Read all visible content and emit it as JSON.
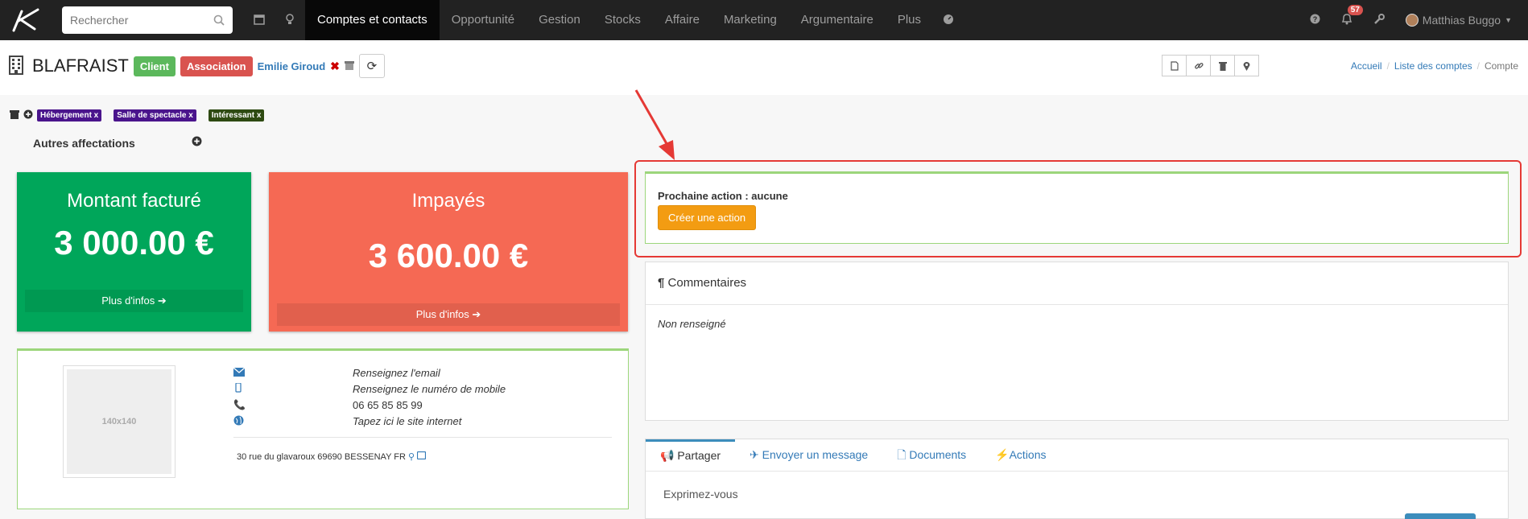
{
  "nav": {
    "search_placeholder": "Rechercher",
    "items": [
      "Comptes et contacts",
      "Opportunité",
      "Gestion",
      "Stocks",
      "Affaire",
      "Marketing",
      "Argumentaire",
      "Plus"
    ],
    "notif_count": "57",
    "user_name": "Matthias Buggo"
  },
  "header": {
    "account_name": "BLAFRAIST",
    "label_client": "Client",
    "label_association": "Association",
    "contact_name": "Emilie Giroud",
    "breadcrumb": [
      "Accueil",
      "Liste des comptes",
      "Compte"
    ]
  },
  "tags": [
    {
      "label": "Hébergement x",
      "color": "#4a148c"
    },
    {
      "label": "Salle de spectacle x",
      "color": "#4a148c"
    },
    {
      "label": "Intéressant x",
      "color": "#2e4a12"
    }
  ],
  "autres_affectations": "Autres affectations",
  "stats": {
    "billed": {
      "title": "Montant facturé",
      "value": "3 000.00 €",
      "more": "Plus d'infos",
      "color": "#00a65a"
    },
    "unpaid": {
      "title": "Impayés",
      "value": "3 600.00 €",
      "more": "Plus d'infos",
      "color": "#f56954"
    }
  },
  "contact": {
    "thumb_label": "140x140",
    "email": "Renseignez l'email",
    "mobile": "Renseignez le numéro de mobile",
    "phone": "06 65 85 85 99",
    "website": "Tapez ici le site internet",
    "address": "30 rue du glavaroux 69690 BESSENAY FR"
  },
  "action": {
    "title": "Prochaine action : aucune",
    "button": "Créer une action"
  },
  "comments": {
    "title": "Commentaires",
    "body": "Non renseigné"
  },
  "share": {
    "tabs": [
      "Partager",
      "Envoyer un message",
      "Documents",
      "Actions"
    ],
    "placeholder": "Exprimez-vous"
  },
  "colors": {
    "highlight": "#e53935",
    "accent_green": "#9cd67b",
    "action_orange": "#f39c12"
  }
}
